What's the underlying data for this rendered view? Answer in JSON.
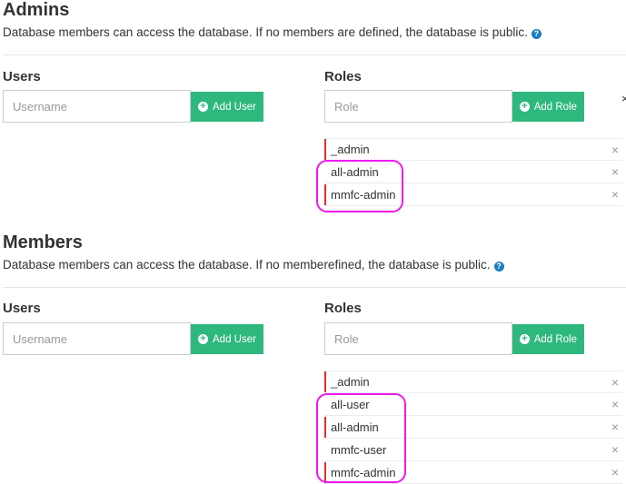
{
  "admins": {
    "title": "Admins",
    "description": "Database members can access the database. If no members are defined, the database is public.",
    "users_heading": "Users",
    "roles_heading": "Roles",
    "username_placeholder": "Username",
    "role_placeholder": "Role",
    "add_user_label": "Add User",
    "add_role_label": "Add Role",
    "roles": [
      {
        "name": "_admin",
        "marker": true
      },
      {
        "name": "all-admin",
        "marker": false
      },
      {
        "name": "mmfc-admin",
        "marker": true
      }
    ]
  },
  "members": {
    "title": "Members",
    "description": "Database members can access the database. If no memberefined, the database is public.",
    "users_heading": "Users",
    "roles_heading": "Roles",
    "username_placeholder": "Username",
    "role_placeholder": "Role",
    "add_user_label": "Add User",
    "add_role_label": "Add Role",
    "roles": [
      {
        "name": "_admin",
        "marker": true
      },
      {
        "name": "all-user",
        "marker": false
      },
      {
        "name": "all-admin",
        "marker": true
      },
      {
        "name": "mmfc-user",
        "marker": false
      },
      {
        "name": "mmfc-admin",
        "marker": true
      }
    ]
  },
  "icons": {
    "help": "question-circle-icon",
    "add": "plus-circle-icon",
    "remove": "close-icon"
  },
  "glyphs": {
    "help": "?",
    "plus": "+",
    "remove": "×",
    "edge_close": "×"
  },
  "colors": {
    "button": "#2eb87e",
    "help": "#1a7bc1",
    "role_marker": "#d9322b",
    "annotation": "#ee19ee"
  }
}
